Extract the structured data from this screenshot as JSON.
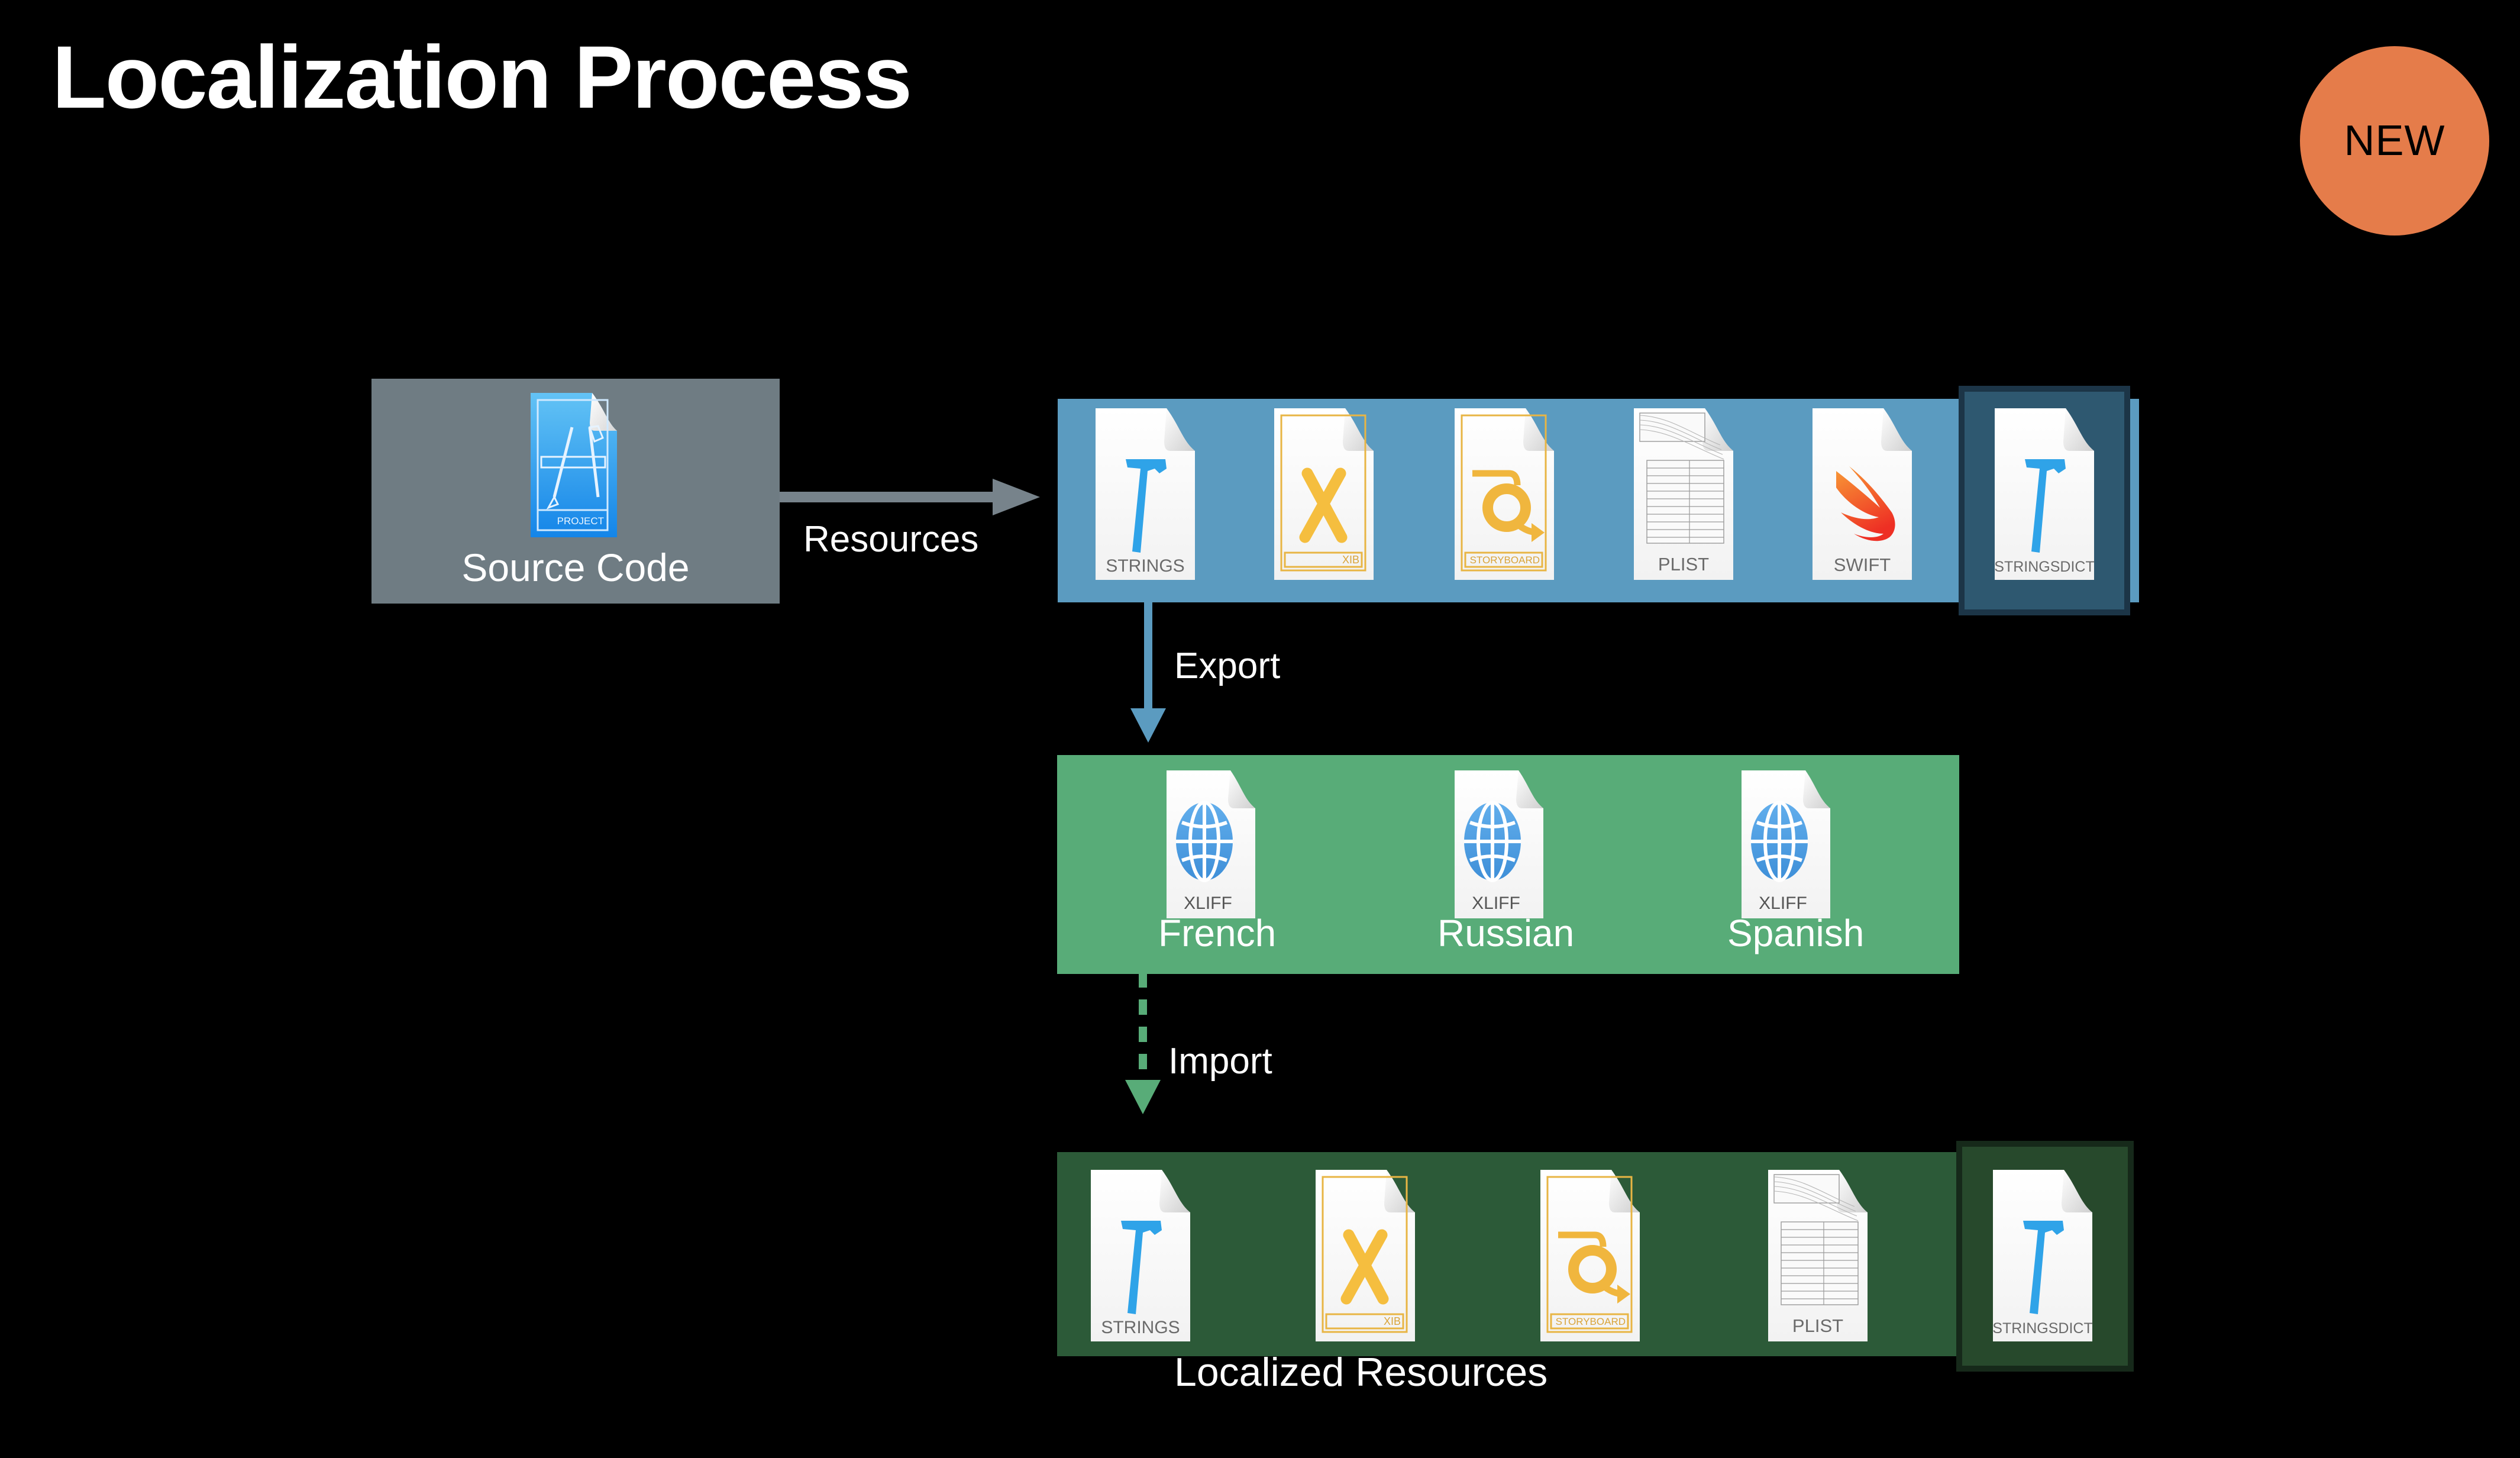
{
  "slide": {
    "title": "Localization Process",
    "badge": {
      "label": "NEW",
      "color": "#E57C4A"
    }
  },
  "colors": {
    "background": "#000000",
    "source_box": "#6F7C83",
    "resources_bar": "#5B9BC0",
    "xliff_bar": "#58AC78",
    "localized_bar": "#2C5A38",
    "stringsdict_highlight": "#2E5870",
    "stringsdict_highlight_border": "#1C3547",
    "stringsdict_highlight_localized": "#27492C",
    "stringsdict_highlight_localized_border": "#16291A",
    "resources_arrow": "#77838B",
    "export_arrow": "#5B9BC0",
    "import_arrow": "#58AC78"
  },
  "source": {
    "label": "Source Code",
    "icon": {
      "name": "xcode-project-file-icon",
      "badge_text": "PROJECT"
    }
  },
  "connectors": [
    {
      "name": "resources",
      "label": "Resources",
      "style": "solid",
      "direction": "right",
      "color": "#77838B"
    },
    {
      "name": "export",
      "label": "Export",
      "style": "solid",
      "direction": "down",
      "color": "#5B9BC0"
    },
    {
      "name": "import",
      "label": "Import",
      "style": "dashed",
      "direction": "down",
      "color": "#58AC78"
    }
  ],
  "resources": {
    "files": [
      {
        "name": "strings-file-icon",
        "label": "STRINGS",
        "kind": "hammer",
        "highlighted": false
      },
      {
        "name": "xib-file-icon",
        "label": "XIB",
        "kind": "xcode-x",
        "highlighted": false
      },
      {
        "name": "storyboard-file-icon",
        "label": "STORYBOARD",
        "kind": "storyboard",
        "highlighted": false
      },
      {
        "name": "plist-file-icon",
        "label": "PLIST",
        "kind": "plist",
        "highlighted": false
      },
      {
        "name": "swift-file-icon",
        "label": "SWIFT",
        "kind": "swift",
        "highlighted": false
      },
      {
        "name": "stringsdict-file-icon",
        "label": "STRINGSDICT",
        "kind": "hammer",
        "highlighted": true
      }
    ]
  },
  "xliff": {
    "files": [
      {
        "name": "xliff-file-icon",
        "label": "XLIFF",
        "language": "French"
      },
      {
        "name": "xliff-file-icon",
        "label": "XLIFF",
        "language": "Russian"
      },
      {
        "name": "xliff-file-icon",
        "label": "XLIFF",
        "language": "Spanish"
      }
    ]
  },
  "localized": {
    "caption": "Localized Resources",
    "files": [
      {
        "name": "strings-file-icon",
        "label": "STRINGS",
        "kind": "hammer",
        "highlighted": false
      },
      {
        "name": "xib-file-icon",
        "label": "XIB",
        "kind": "xcode-x",
        "highlighted": false
      },
      {
        "name": "storyboard-file-icon",
        "label": "STORYBOARD",
        "kind": "storyboard",
        "highlighted": false
      },
      {
        "name": "plist-file-icon",
        "label": "PLIST",
        "kind": "plist",
        "highlighted": false
      },
      {
        "name": "stringsdict-file-icon",
        "label": "STRINGSDICT",
        "kind": "hammer",
        "highlighted": true
      }
    ]
  }
}
